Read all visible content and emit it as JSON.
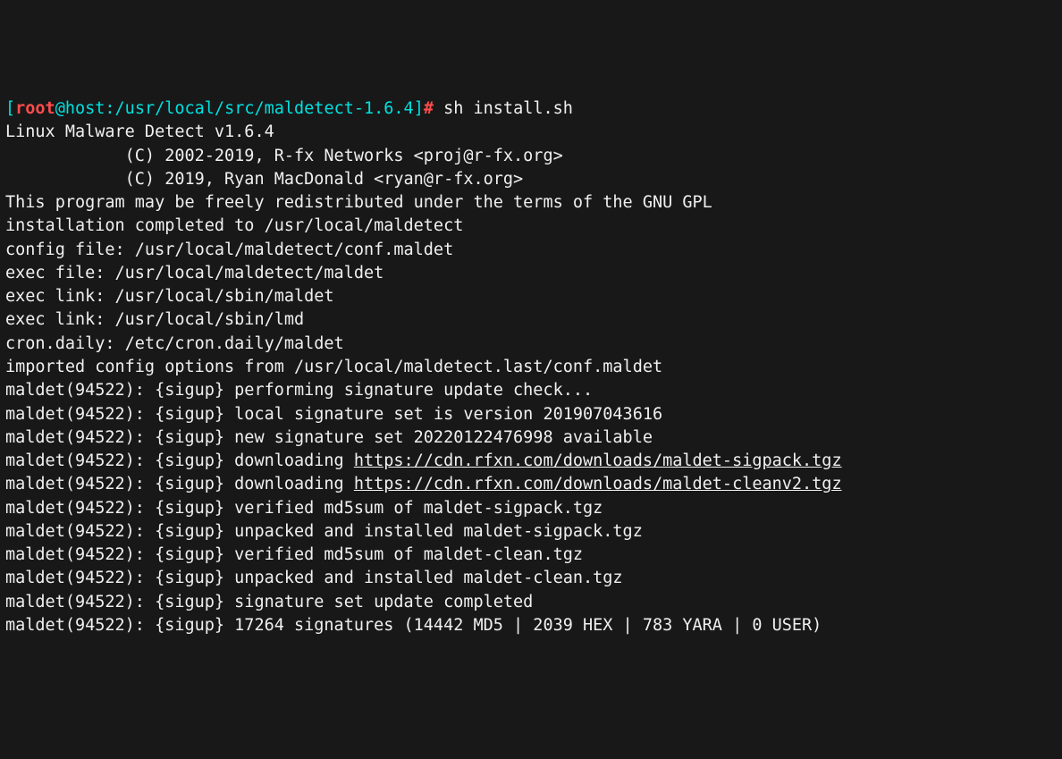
{
  "prompt": {
    "lbr": "[",
    "user": "root",
    "at": "@",
    "host": "host",
    "colon": ":",
    "cwd": "/usr/local/src/maldetect-1.6.4",
    "rbr": "]",
    "hash": "#",
    "cmd": " sh install.sh"
  },
  "lines": [
    "Linux Malware Detect v1.6.4",
    "            (C) 2002-2019, R-fx Networks <proj@r-fx.org>",
    "            (C) 2019, Ryan MacDonald <ryan@r-fx.org>",
    "This program may be freely redistributed under the terms of the GNU GPL",
    "",
    "installation completed to /usr/local/maldetect",
    "config file: /usr/local/maldetect/conf.maldet",
    "exec file: /usr/local/maldetect/maldet",
    "exec link: /usr/local/sbin/maldet",
    "exec link: /usr/local/sbin/lmd",
    "cron.daily: /etc/cron.daily/maldet",
    "imported config options from /usr/local/maldetect.last/conf.maldet",
    "maldet(94522): {sigup} performing signature update check...",
    "maldet(94522): {sigup} local signature set is version 201907043616",
    "maldet(94522): {sigup} new signature set 20220122476998 available"
  ],
  "dl1": {
    "prefix": "maldet(94522): {sigup} downloading ",
    "url": "https://cdn.rfxn.com/downloads/maldet-sigpack.tgz"
  },
  "dl2": {
    "prefix": "maldet(94522): {sigup} downloading ",
    "url": "https://cdn.rfxn.com/downloads/maldet-cleanv2.tgz"
  },
  "tail": [
    "maldet(94522): {sigup} verified md5sum of maldet-sigpack.tgz",
    "maldet(94522): {sigup} unpacked and installed maldet-sigpack.tgz",
    "maldet(94522): {sigup} verified md5sum of maldet-clean.tgz",
    "maldet(94522): {sigup} unpacked and installed maldet-clean.tgz",
    "maldet(94522): {sigup} signature set update completed",
    "maldet(94522): {sigup} 17264 signatures (14442 MD5 | 2039 HEX | 783 YARA | 0 USER)"
  ]
}
